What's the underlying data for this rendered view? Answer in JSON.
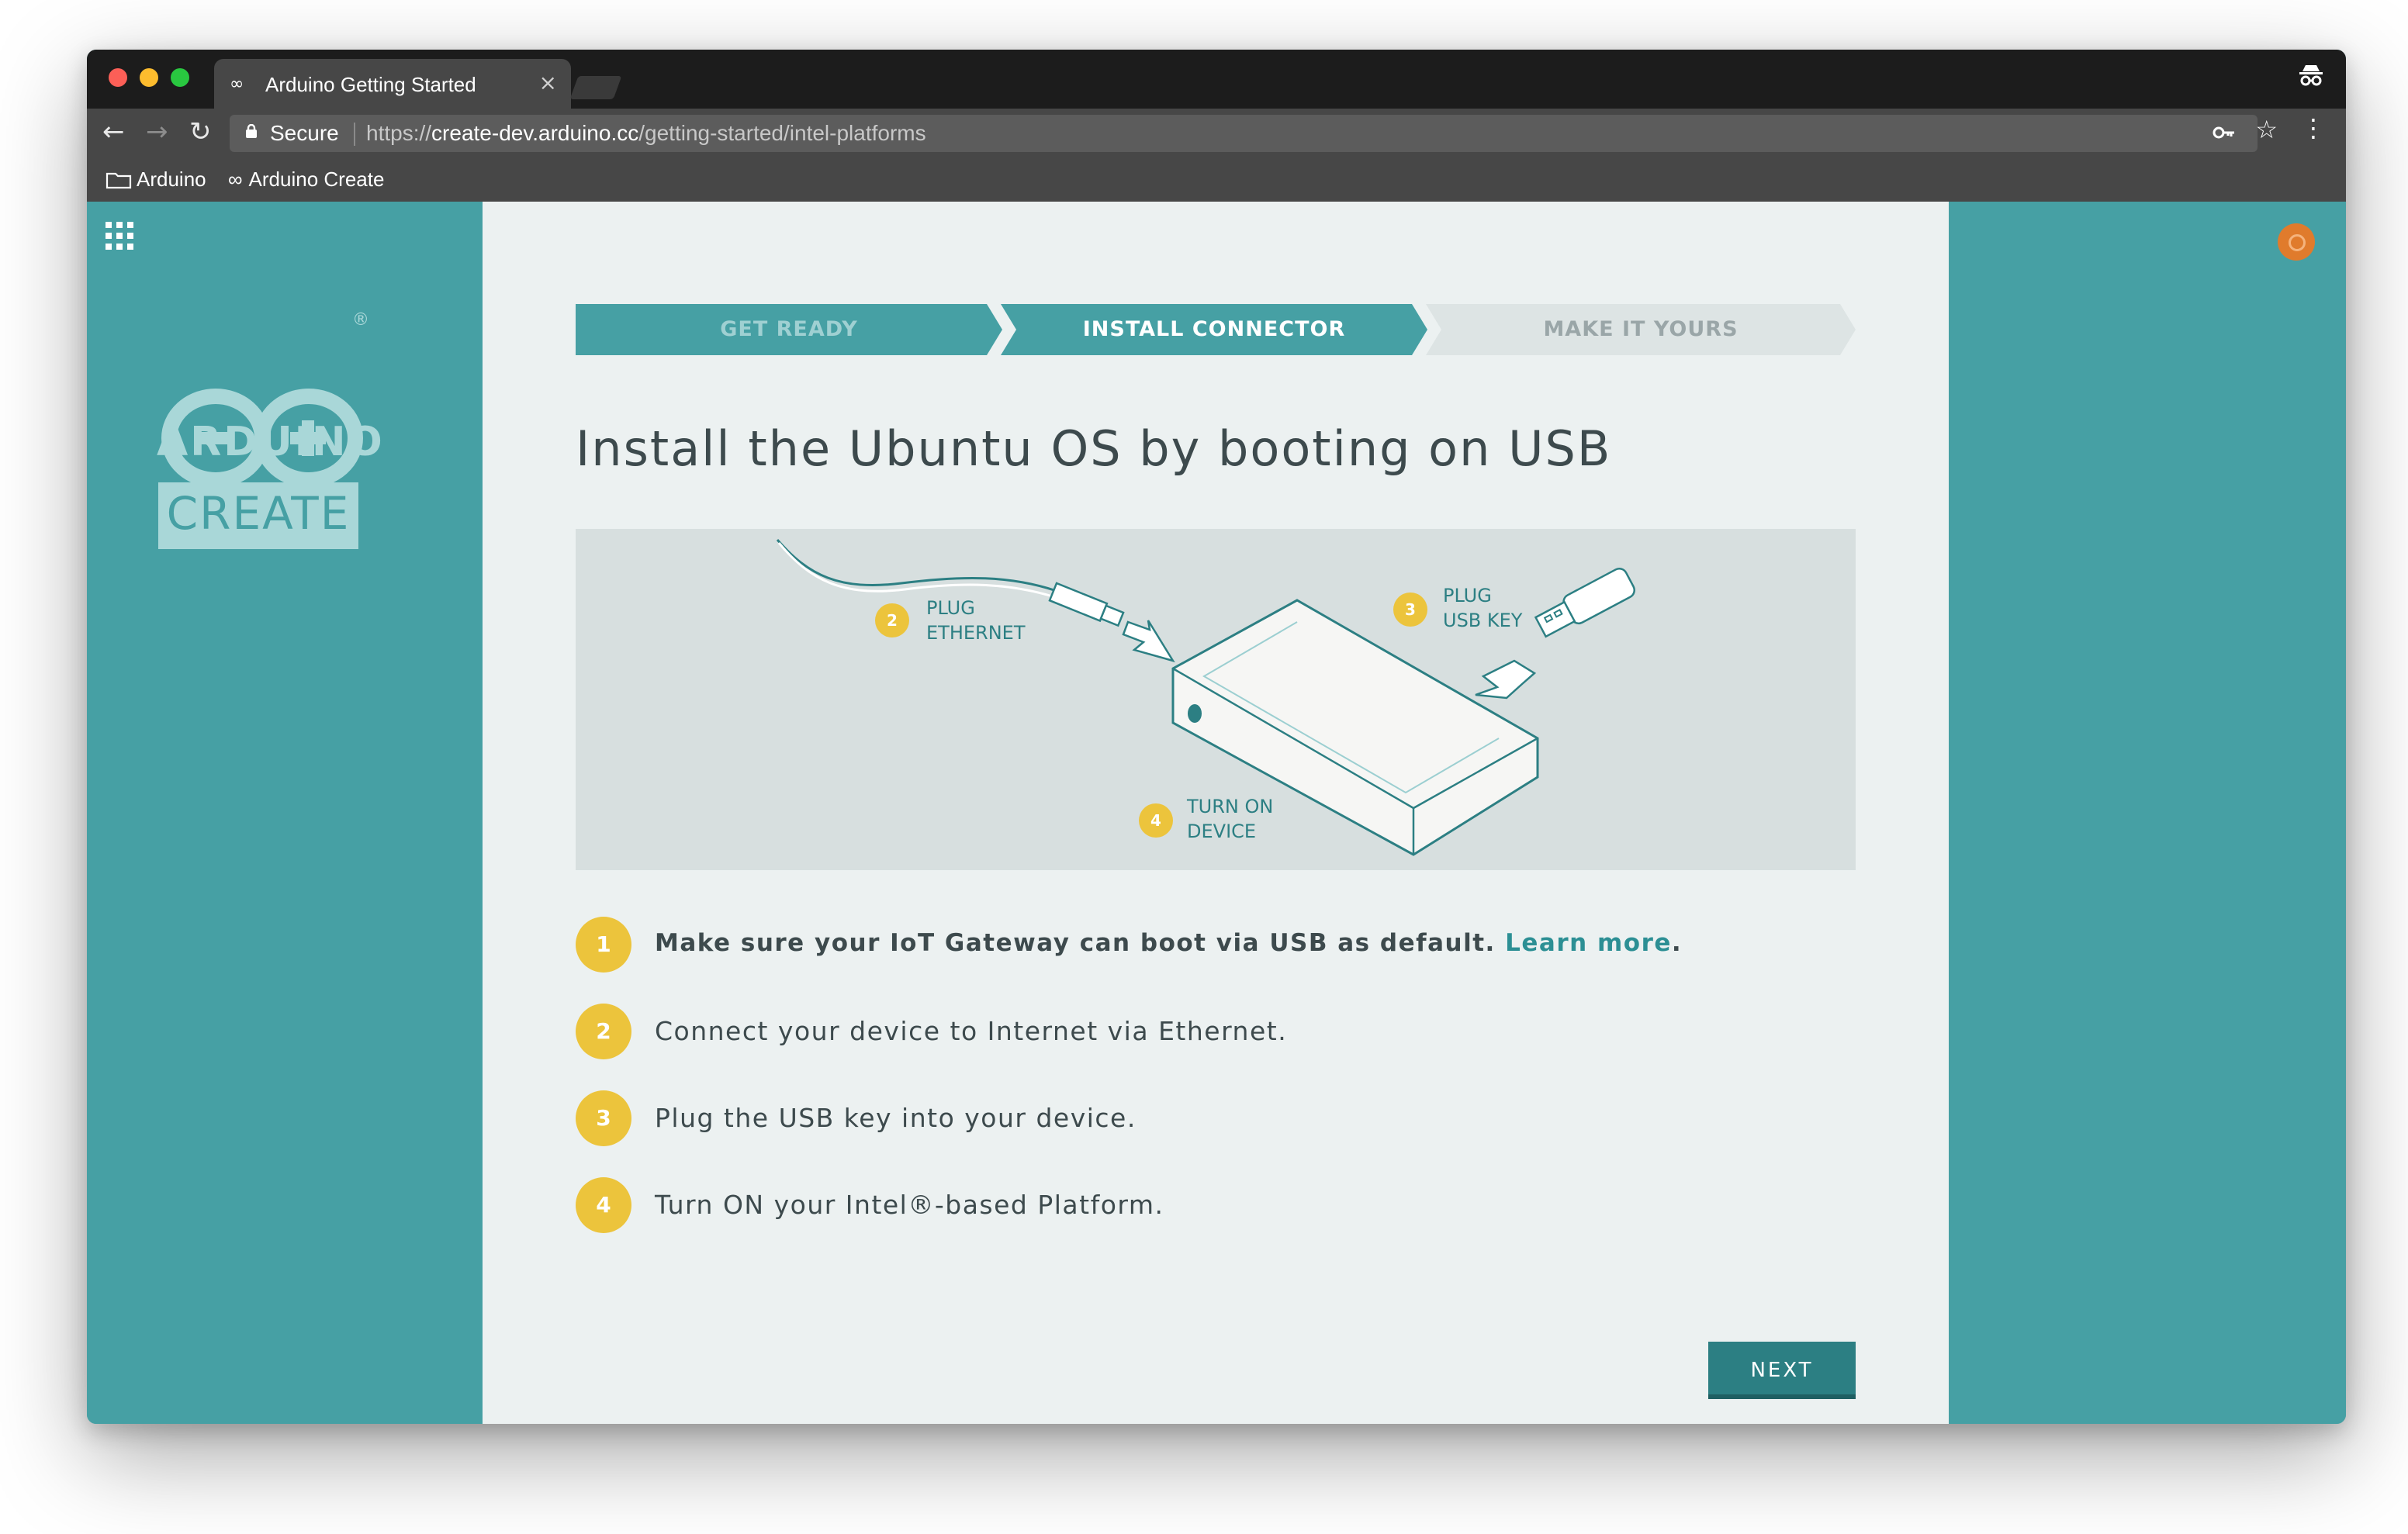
{
  "browser": {
    "tab_title": "Arduino Getting Started",
    "tab_close": "×",
    "secure_label": "Secure",
    "url_scheme": "https://",
    "url_host": "create-dev.arduino.cc",
    "url_path": "/getting-started/intel-platforms",
    "bookmarks": [
      {
        "label": "Arduino",
        "icon": "folder-icon"
      },
      {
        "label": "Arduino Create",
        "icon": "infinity-icon"
      }
    ]
  },
  "sidebar": {
    "logo_word": "ARDUINO",
    "logo_sub": "CREATE",
    "registered": "®"
  },
  "stepper": {
    "steps": [
      {
        "label": "GET READY",
        "state": "done"
      },
      {
        "label": "INSTALL CONNECTOR",
        "state": "active"
      },
      {
        "label": "MAKE IT YOURS",
        "state": "upcoming"
      }
    ]
  },
  "page": {
    "heading": "Install the Ubuntu OS by booting on USB"
  },
  "illustration": {
    "labels": [
      {
        "num": "2",
        "line1": "PLUG",
        "line2": "ETHERNET"
      },
      {
        "num": "3",
        "line1": "PLUG",
        "line2": "USB KEY"
      },
      {
        "num": "4",
        "line1": "TURN ON",
        "line2": "DEVICE"
      }
    ]
  },
  "instructions": [
    {
      "num": "1",
      "text": "Make sure your IoT Gateway can boot via USB as default. ",
      "link": "Learn more",
      "suffix": "."
    },
    {
      "num": "2",
      "text": "Connect your device to Internet via Ethernet."
    },
    {
      "num": "3",
      "text": "Plug the USB key into your device."
    },
    {
      "num": "4",
      "text": "Turn ON your Intel®-based Platform."
    }
  ],
  "actions": {
    "next_label": "NEXT"
  },
  "colors": {
    "teal": "#46a0a4",
    "dark_teal": "#2c7f83",
    "yellow": "#ecc43c",
    "panel": "#ecf1f1",
    "user_badge": "#e07b2c"
  }
}
